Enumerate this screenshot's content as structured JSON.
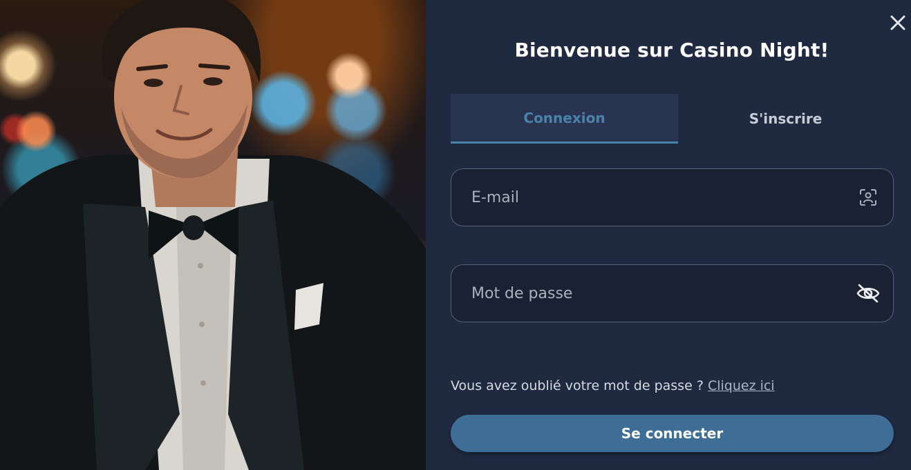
{
  "hero": {
    "image_alt": "Homme souriant en smoking avec nœud papillon dans un casino"
  },
  "modal": {
    "title": "Bienvenue sur Casino Night!",
    "tabs": [
      {
        "label": "Connexion",
        "active": true
      },
      {
        "label": "S'inscrire",
        "active": false
      }
    ],
    "email": {
      "placeholder": "E-mail",
      "value": "",
      "icon": "user-scan-icon"
    },
    "password": {
      "placeholder": "Mot de passe",
      "value": "",
      "icon": "eye-slash-icon"
    },
    "forgot_text": "Vous avez oublié votre mot de passe ?",
    "forgot_link": "Cliquez ici",
    "submit_label": "Se connecter",
    "close_icon": "close-icon"
  },
  "colors": {
    "panel_bg": "#1f2940",
    "tab_active_bg": "#293451",
    "accent": "#4a82aa",
    "button": "#3e6d96",
    "field_bg": "#1a2133",
    "field_border": "#56627a"
  }
}
